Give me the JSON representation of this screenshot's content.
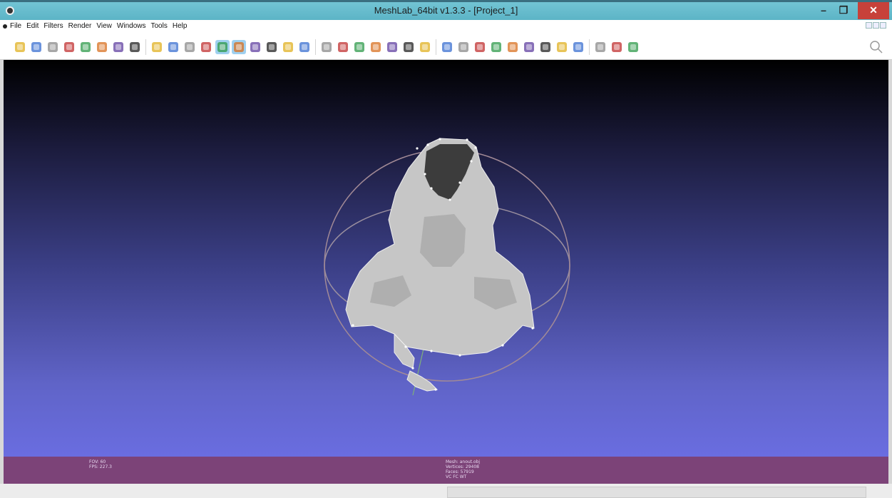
{
  "window": {
    "title": "MeshLab_64bit v1.3.3 - [Project_1]",
    "minimize_glyph": "–",
    "maximize_glyph": "❐",
    "close_glyph": "✕"
  },
  "menu": {
    "items": [
      "File",
      "Edit",
      "Filters",
      "Render",
      "View",
      "Windows",
      "Tools",
      "Help"
    ]
  },
  "toolbar": {
    "icons": [
      "new-project-icon",
      "open-project-icon",
      "open-mesh-icon",
      "reload-icon",
      "save-icon",
      "snapshot-icon",
      "layer-icon",
      "record-icon",
      "bounding-box-icon",
      "points-icon",
      "wireframe-icon",
      "hidden-lines-icon",
      "flat-shading-icon",
      "smooth-shading-icon",
      "texture-icon",
      "light-icon",
      "backface-icon",
      "double-side-icon",
      "trackball-icon",
      "annotation-icon",
      "raster-icon",
      "color-icon",
      "axis-icon",
      "paint-brush-icon",
      "pen-icon",
      "pickpoints-icon",
      "select-faces-icon",
      "select-vertices-icon",
      "color-paint-icon",
      "measure-icon",
      "align-icon",
      "manipulator-icon",
      "manipulator-alt-icon",
      "info-icon",
      "delete-faces-icon",
      "delete-vertices-icon",
      "delete-all-icon"
    ],
    "active": [
      "flat-shading-icon",
      "smooth-shading-icon"
    ]
  },
  "hud": {
    "left": [
      "FOV: 60",
      "FPS: 227.3"
    ],
    "right": [
      "Mesh: anout.obj",
      "Vertices: 29408",
      "Faces: 57919",
      "VC FC WT"
    ]
  },
  "colors": {
    "titlebar": "#62b9cb",
    "close_button": "#c7413a",
    "hud_background": "#7c4378",
    "viewport_top": "#000000",
    "viewport_bottom": "#6a6de0",
    "mesh": "#c8c8c8"
  }
}
